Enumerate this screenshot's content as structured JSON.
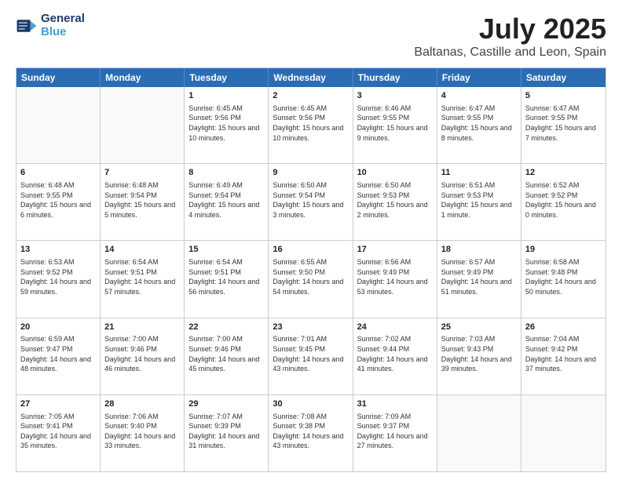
{
  "logo": {
    "line1": "General",
    "line2": "Blue"
  },
  "title": "July 2025",
  "subtitle": "Baltanas, Castille and Leon, Spain",
  "header_days": [
    "Sunday",
    "Monday",
    "Tuesday",
    "Wednesday",
    "Thursday",
    "Friday",
    "Saturday"
  ],
  "weeks": [
    [
      {
        "day": "",
        "sunrise": "",
        "sunset": "",
        "daylight": ""
      },
      {
        "day": "",
        "sunrise": "",
        "sunset": "",
        "daylight": ""
      },
      {
        "day": "1",
        "sunrise": "Sunrise: 6:45 AM",
        "sunset": "Sunset: 9:56 PM",
        "daylight": "Daylight: 15 hours and 10 minutes."
      },
      {
        "day": "2",
        "sunrise": "Sunrise: 6:45 AM",
        "sunset": "Sunset: 9:56 PM",
        "daylight": "Daylight: 15 hours and 10 minutes."
      },
      {
        "day": "3",
        "sunrise": "Sunrise: 6:46 AM",
        "sunset": "Sunset: 9:55 PM",
        "daylight": "Daylight: 15 hours and 9 minutes."
      },
      {
        "day": "4",
        "sunrise": "Sunrise: 6:47 AM",
        "sunset": "Sunset: 9:55 PM",
        "daylight": "Daylight: 15 hours and 8 minutes."
      },
      {
        "day": "5",
        "sunrise": "Sunrise: 6:47 AM",
        "sunset": "Sunset: 9:55 PM",
        "daylight": "Daylight: 15 hours and 7 minutes."
      }
    ],
    [
      {
        "day": "6",
        "sunrise": "Sunrise: 6:48 AM",
        "sunset": "Sunset: 9:55 PM",
        "daylight": "Daylight: 15 hours and 6 minutes."
      },
      {
        "day": "7",
        "sunrise": "Sunrise: 6:48 AM",
        "sunset": "Sunset: 9:54 PM",
        "daylight": "Daylight: 15 hours and 5 minutes."
      },
      {
        "day": "8",
        "sunrise": "Sunrise: 6:49 AM",
        "sunset": "Sunset: 9:54 PM",
        "daylight": "Daylight: 15 hours and 4 minutes."
      },
      {
        "day": "9",
        "sunrise": "Sunrise: 6:50 AM",
        "sunset": "Sunset: 9:54 PM",
        "daylight": "Daylight: 15 hours and 3 minutes."
      },
      {
        "day": "10",
        "sunrise": "Sunrise: 6:50 AM",
        "sunset": "Sunset: 9:53 PM",
        "daylight": "Daylight: 15 hours and 2 minutes."
      },
      {
        "day": "11",
        "sunrise": "Sunrise: 6:51 AM",
        "sunset": "Sunset: 9:53 PM",
        "daylight": "Daylight: 15 hours and 1 minute."
      },
      {
        "day": "12",
        "sunrise": "Sunrise: 6:52 AM",
        "sunset": "Sunset: 9:52 PM",
        "daylight": "Daylight: 15 hours and 0 minutes."
      }
    ],
    [
      {
        "day": "13",
        "sunrise": "Sunrise: 6:53 AM",
        "sunset": "Sunset: 9:52 PM",
        "daylight": "Daylight: 14 hours and 59 minutes."
      },
      {
        "day": "14",
        "sunrise": "Sunrise: 6:54 AM",
        "sunset": "Sunset: 9:51 PM",
        "daylight": "Daylight: 14 hours and 57 minutes."
      },
      {
        "day": "15",
        "sunrise": "Sunrise: 6:54 AM",
        "sunset": "Sunset: 9:51 PM",
        "daylight": "Daylight: 14 hours and 56 minutes."
      },
      {
        "day": "16",
        "sunrise": "Sunrise: 6:55 AM",
        "sunset": "Sunset: 9:50 PM",
        "daylight": "Daylight: 14 hours and 54 minutes."
      },
      {
        "day": "17",
        "sunrise": "Sunrise: 6:56 AM",
        "sunset": "Sunset: 9:49 PM",
        "daylight": "Daylight: 14 hours and 53 minutes."
      },
      {
        "day": "18",
        "sunrise": "Sunrise: 6:57 AM",
        "sunset": "Sunset: 9:49 PM",
        "daylight": "Daylight: 14 hours and 51 minutes."
      },
      {
        "day": "19",
        "sunrise": "Sunrise: 6:58 AM",
        "sunset": "Sunset: 9:48 PM",
        "daylight": "Daylight: 14 hours and 50 minutes."
      }
    ],
    [
      {
        "day": "20",
        "sunrise": "Sunrise: 6:59 AM",
        "sunset": "Sunset: 9:47 PM",
        "daylight": "Daylight: 14 hours and 48 minutes."
      },
      {
        "day": "21",
        "sunrise": "Sunrise: 7:00 AM",
        "sunset": "Sunset: 9:46 PM",
        "daylight": "Daylight: 14 hours and 46 minutes."
      },
      {
        "day": "22",
        "sunrise": "Sunrise: 7:00 AM",
        "sunset": "Sunset: 9:46 PM",
        "daylight": "Daylight: 14 hours and 45 minutes."
      },
      {
        "day": "23",
        "sunrise": "Sunrise: 7:01 AM",
        "sunset": "Sunset: 9:45 PM",
        "daylight": "Daylight: 14 hours and 43 minutes."
      },
      {
        "day": "24",
        "sunrise": "Sunrise: 7:02 AM",
        "sunset": "Sunset: 9:44 PM",
        "daylight": "Daylight: 14 hours and 41 minutes."
      },
      {
        "day": "25",
        "sunrise": "Sunrise: 7:03 AM",
        "sunset": "Sunset: 9:43 PM",
        "daylight": "Daylight: 14 hours and 39 minutes."
      },
      {
        "day": "26",
        "sunrise": "Sunrise: 7:04 AM",
        "sunset": "Sunset: 9:42 PM",
        "daylight": "Daylight: 14 hours and 37 minutes."
      }
    ],
    [
      {
        "day": "27",
        "sunrise": "Sunrise: 7:05 AM",
        "sunset": "Sunset: 9:41 PM",
        "daylight": "Daylight: 14 hours and 35 minutes."
      },
      {
        "day": "28",
        "sunrise": "Sunrise: 7:06 AM",
        "sunset": "Sunset: 9:40 PM",
        "daylight": "Daylight: 14 hours and 33 minutes."
      },
      {
        "day": "29",
        "sunrise": "Sunrise: 7:07 AM",
        "sunset": "Sunset: 9:39 PM",
        "daylight": "Daylight: 14 hours and 31 minutes."
      },
      {
        "day": "30",
        "sunrise": "Sunrise: 7:08 AM",
        "sunset": "Sunset: 9:38 PM",
        "daylight": "Daylight: 14 hours and 43 minutes."
      },
      {
        "day": "31",
        "sunrise": "Sunrise: 7:09 AM",
        "sunset": "Sunset: 9:37 PM",
        "daylight": "Daylight: 14 hours and 27 minutes."
      },
      {
        "day": "",
        "sunrise": "",
        "sunset": "",
        "daylight": ""
      },
      {
        "day": "",
        "sunrise": "",
        "sunset": "",
        "daylight": ""
      }
    ]
  ]
}
